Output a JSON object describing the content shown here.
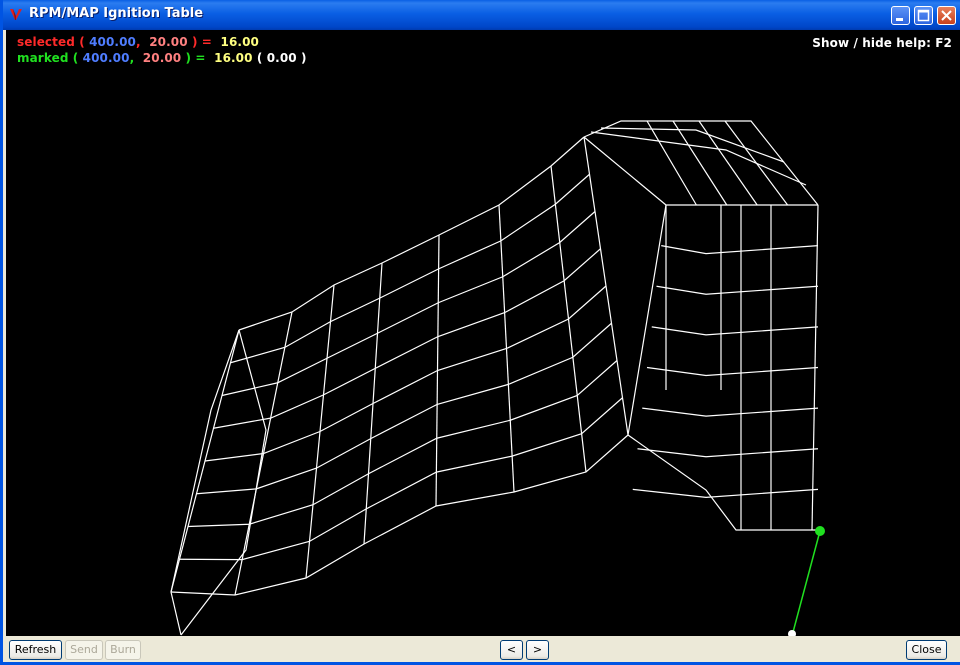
{
  "window": {
    "title": "RPM/MAP Ignition Table"
  },
  "hud": {
    "selected": {
      "label": "selected",
      "rpm": "400.00",
      "map": "20.00",
      "value": "16.00"
    },
    "marked": {
      "label": "marked",
      "rpm": "400.00",
      "map": "20.00",
      "value": "16.00",
      "delta": "0.00"
    },
    "help": "Show / hide help: F2"
  },
  "buttons": {
    "refresh": "Refresh",
    "send": "Send",
    "burn": "Burn",
    "prev": "<",
    "next": ">",
    "close": "Close"
  },
  "colors": {
    "selected_label": "#ff2a2a",
    "rpm": "#4f7dff",
    "map": "#ff8080",
    "value": "#ffff80",
    "marked_label": "#20e020",
    "mesh": "#ffffff",
    "canvas_bg": "#000000"
  }
}
